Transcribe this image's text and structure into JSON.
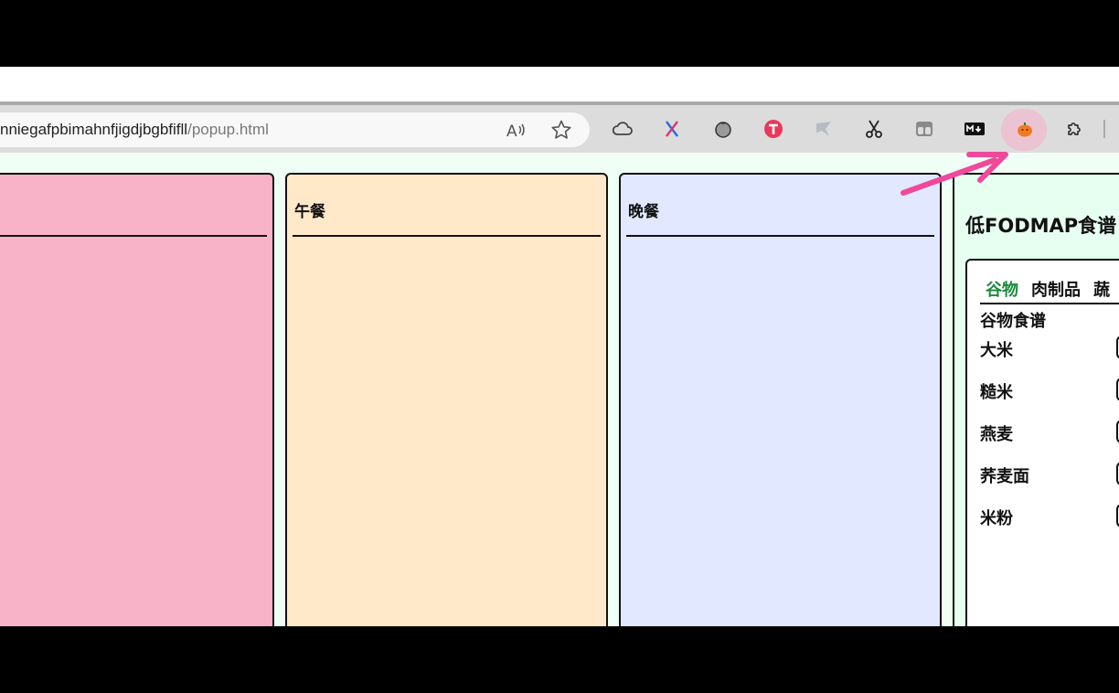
{
  "browser": {
    "url_host": "nniegafpbimahnfjigdjbgbfifll",
    "url_path": "/popup.html"
  },
  "toolbar": {
    "read_aloud_icon": "read-aloud-icon",
    "favorite_icon": "star-icon",
    "extensions": [
      "cloud-icon",
      "x-logo-icon",
      "tomato-icon",
      "t-badge-icon",
      "bird-icon",
      "scissors-icon",
      "split-view-icon",
      "markdown-icon",
      "pumpkin-icon",
      "puzzle-icon"
    ],
    "active_extension": "pumpkin-icon"
  },
  "meals": [
    {
      "title": "",
      "color": "#f9b3c9"
    },
    {
      "title": "午餐",
      "color": "#ffe9c9"
    },
    {
      "title": "晚餐",
      "color": "#e1e8ff"
    }
  ],
  "recipes": {
    "title": "低FODMAP食谱",
    "tabs": [
      "谷物",
      "肉制品",
      "蔬"
    ],
    "active_tab": "谷物",
    "section_heading": "谷物食谱",
    "items": [
      "大米",
      "糙米",
      "燕麦",
      "荞麦面",
      "米粉"
    ]
  },
  "colors": {
    "accent_green": "#1a8a3a",
    "arrow_pink": "#f0489a"
  }
}
